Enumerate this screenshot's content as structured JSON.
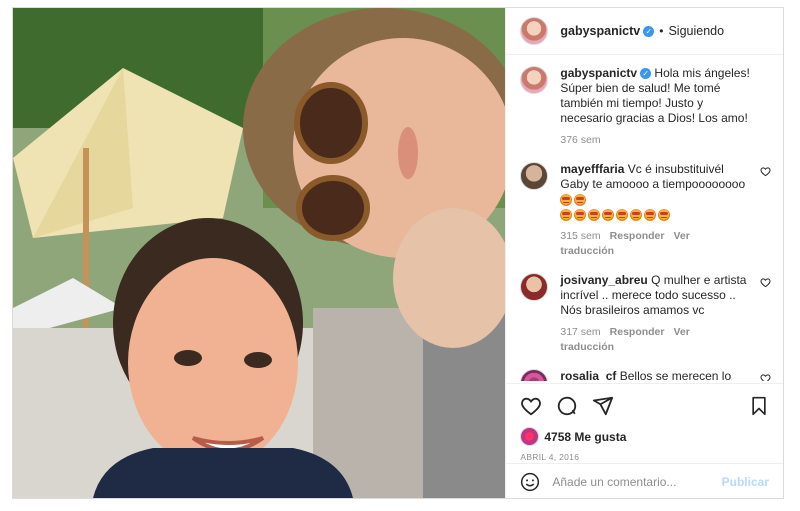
{
  "header": {
    "username": "gabyspanictv",
    "follow_label": "Siguiendo",
    "dot": "•"
  },
  "caption": {
    "username": "gabyspanictv",
    "text": "Hola mis ángeles! Súper bien de salud! Me tomé también mi tiempo! Justo y necesario gracias a Dios! Los amo!",
    "time": "376 sem"
  },
  "comments": [
    {
      "username": "mayefffaria",
      "text": "Vc é insubstituivél Gaby te amoooo a tiempoooooooo",
      "time": "315 sem",
      "reply": "Responder",
      "translate": "Ver traducción"
    },
    {
      "username": "josivany_abreu",
      "text": "Q mulher e artista incrível .. merece todo sucesso .. Nós brasileiros amamos vc",
      "time": "317 sem",
      "reply": "Responder",
      "translate": "Ver traducción"
    },
    {
      "username": "rosalia_cf",
      "text": "Bellos se merecen lo mejor"
    }
  ],
  "likes": {
    "text": "4758 Me gusta"
  },
  "date": "ABRIL 4, 2016",
  "add_comment": {
    "placeholder": "Añade un comentario...",
    "publish": "Publicar"
  },
  "colors": {
    "verified": "#3897f0",
    "publish_disabled": "#b3dbff",
    "muted": "#8e8e8e"
  },
  "icons": [
    "more-options-icon",
    "heart-icon",
    "comment-icon",
    "share-icon",
    "bookmark-icon",
    "emoji-icon"
  ]
}
